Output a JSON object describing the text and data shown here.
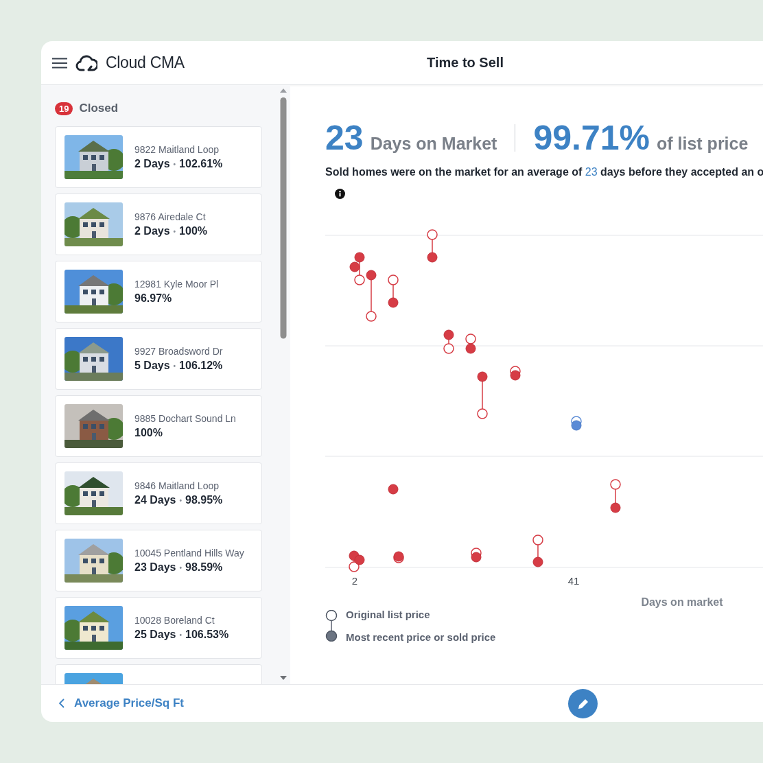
{
  "header": {
    "app_name": "Cloud CMA",
    "title": "Time to Sell"
  },
  "sidebar": {
    "group": {
      "count": "19",
      "label": "Closed"
    },
    "separator": "•",
    "listings": [
      {
        "kind": "listing",
        "address": "9822 Maitland Loop",
        "days": "2 Days",
        "percent": "102.61%"
      },
      {
        "kind": "listing",
        "address": "9876 Airedale Ct",
        "days": "2 Days",
        "percent": "100%"
      },
      {
        "kind": "listing",
        "address": "12981 Kyle Moor Pl",
        "percent": "96.97%"
      },
      {
        "kind": "listing",
        "address": "9927 Broadsword Dr",
        "days": "5 Days",
        "percent": "106.12%"
      },
      {
        "kind": "listing",
        "address": "9885 Dochart Sound Ln",
        "percent": "100%"
      },
      {
        "kind": "listing",
        "address": "9846 Maitland Loop",
        "days": "24 Days",
        "percent": "98.95%"
      },
      {
        "kind": "listing",
        "address": "10045 Pentland Hills Way",
        "days": "23 Days",
        "percent": "98.59%"
      },
      {
        "kind": "listing",
        "address": "10028 Boreland Ct",
        "days": "25 Days",
        "percent": "106.53%"
      },
      {
        "kind": "picture"
      }
    ]
  },
  "summary": {
    "days_value": "23",
    "days_label": "Days on Market",
    "pct_value": "99.71%",
    "pct_label": "of list price",
    "sentence": [
      {
        "kind": "plain",
        "text": "Sold homes were on the market for an average of "
      },
      {
        "kind": "highlight",
        "text": "23"
      },
      {
        "kind": "plain",
        "text": " days before they accepted an o"
      }
    ]
  },
  "chart": {
    "xticks": [
      "2",
      "41"
    ],
    "xlabel": "Days on market",
    "legend": [
      {
        "kind": "open",
        "label": "Original list price"
      },
      {
        "kind": "filled",
        "label": "Most recent price or sold price"
      }
    ]
  },
  "footer": {
    "back_link": "Average Price/Sq Ft"
  }
}
